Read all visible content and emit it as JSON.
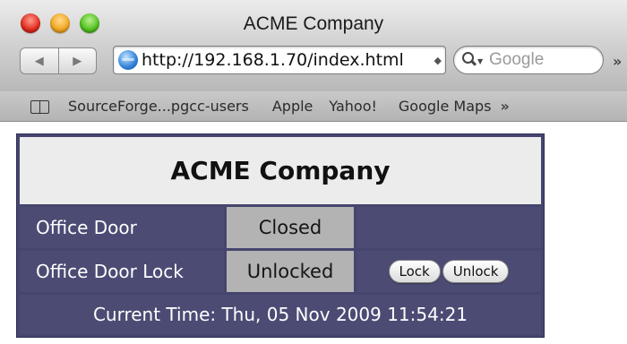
{
  "window": {
    "title": "ACME Company"
  },
  "toolbar": {
    "back_glyph": "◀",
    "forward_glyph": "▶",
    "url": "http://192.168.1.70/index.html",
    "url_arrow": "◆",
    "search_placeholder": "Google",
    "overflow_glyph": "»"
  },
  "bookmarks": {
    "items": [
      "SourceForge...pgcc-users",
      "Apple",
      "Yahoo!",
      "Google Maps"
    ],
    "overflow_glyph": "»"
  },
  "page": {
    "heading": "ACME Company",
    "rows": [
      {
        "label": "Office Door",
        "value": "Closed"
      },
      {
        "label": "Office Door Lock",
        "value": "Unlocked",
        "buttons": [
          "Lock",
          "Unlock"
        ]
      }
    ],
    "current_time": "Current Time: Thu, 05 Nov 2009 11:54:21"
  },
  "colors": {
    "table_border": "#45456e",
    "label_background": "#4b4b74",
    "value_background": "#b3b3b3",
    "header_background": "#ececec"
  }
}
